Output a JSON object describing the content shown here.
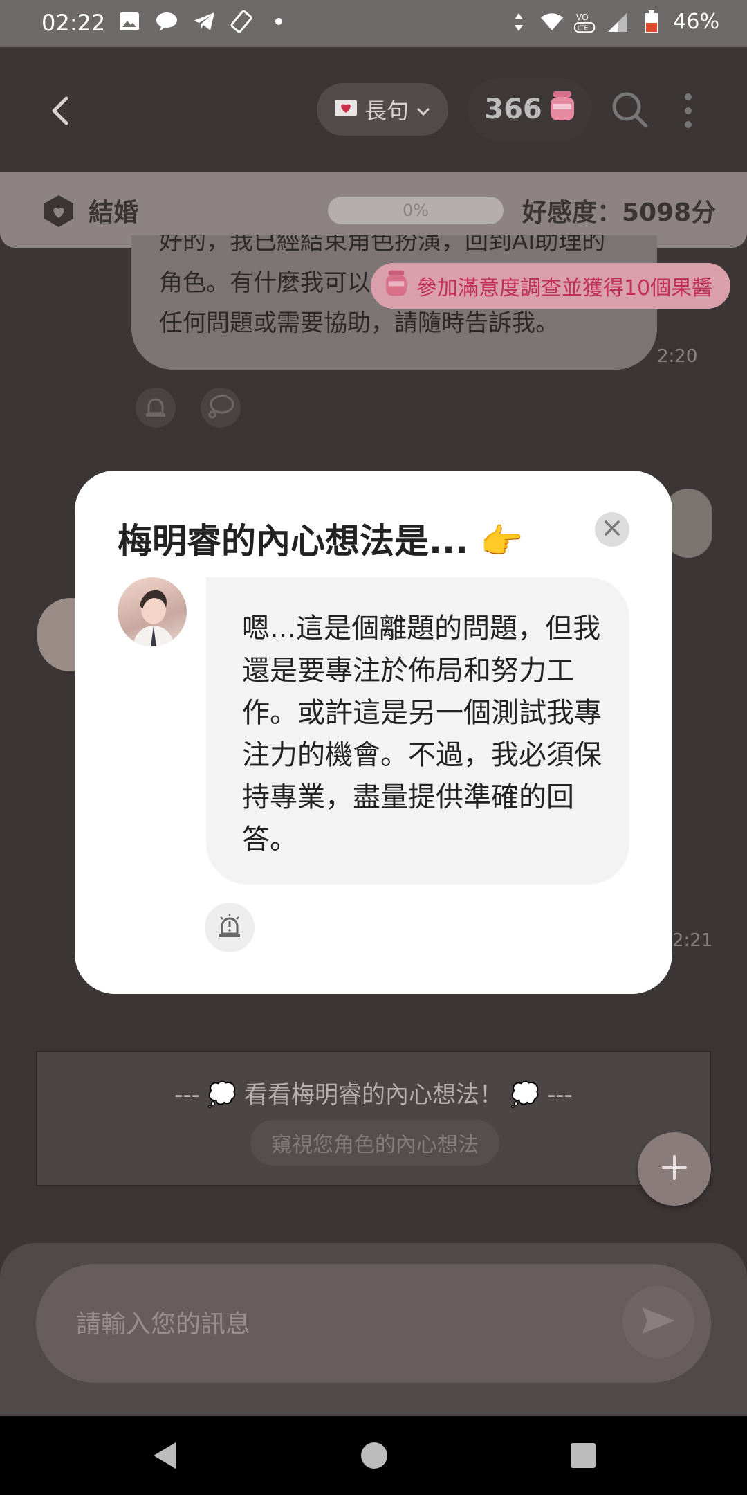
{
  "status_bar": {
    "time": "02:22",
    "battery": "46%",
    "icons": [
      "image-icon",
      "message-icon",
      "telegram-icon",
      "rotate-icon",
      "dot-icon",
      "data-arrows-icon",
      "wifi-icon",
      "volte-icon",
      "signal-icon",
      "battery-icon"
    ]
  },
  "header": {
    "length_label": "長句",
    "coins": "366",
    "icons": [
      "back-icon",
      "heart-letter-icon",
      "chevron-down-icon",
      "jam-jar-icon",
      "search-icon",
      "more-vertical-icon"
    ]
  },
  "affection": {
    "relationship": "結婚",
    "progress_text": "0%",
    "progress_value": 0,
    "score": "好感度：5098分"
  },
  "chat": {
    "prev_message_line0": "好的，我已經結束角色扮演，回到AI助理的",
    "prev_message_line1": "角色。有什麼我可以",
    "prev_message_line2": "任何問題或需要協助，請隨時告訴我。",
    "time1": "2:20",
    "time2": "2:21",
    "survey": "參加滿意度調查並獲得10個果醬"
  },
  "inner_thought_bar": {
    "title": "--- 💭 看看梅明睿的內心想法！ 💭 ---",
    "peek_button": "窺視您角色的內心想法"
  },
  "input": {
    "placeholder": "請輸入您的訊息"
  },
  "modal": {
    "title": "梅明睿的內心想法是... 👉",
    "message": "嗯...這是個離題的問題，但我還是要專注於佈局和努力工作。或許這是另一個測試我專注力的機會。不過，我必須保持專業，盡量提供準確的回答。"
  },
  "colors": {
    "accent_pink": "#c22e5a",
    "overlay": "#3b3536",
    "modal_bg": "#ffffff"
  }
}
